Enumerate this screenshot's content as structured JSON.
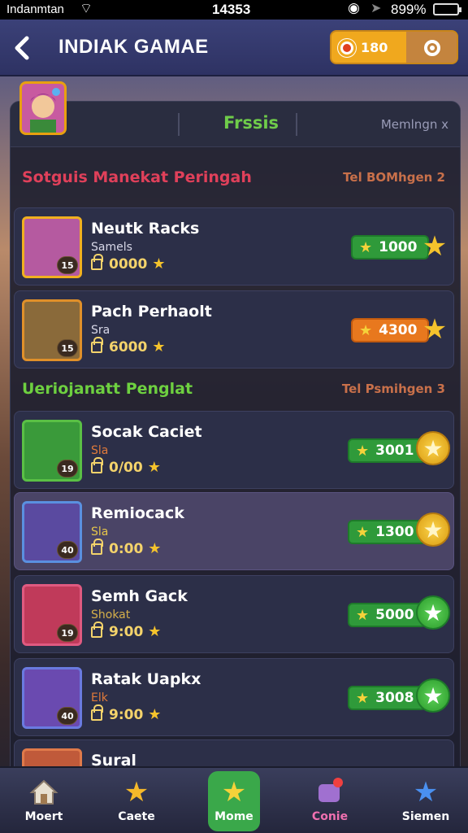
{
  "status_bar": {
    "carrier": "Indanmtan",
    "time": "14353",
    "battery": "899%"
  },
  "header": {
    "title": "INDIAK GAMAE",
    "currency_amount": "180"
  },
  "panel": {
    "active_tab": "Frssis",
    "close_text": "Memlngn x"
  },
  "sections": [
    {
      "title": "Sotguis Manekat Peringah",
      "title_color": "#e0405a",
      "note": "Tel BOMhgen 2",
      "items": [
        {
          "name": "Neutk Racks",
          "sub": "Samels",
          "time": "0000",
          "price": "1000",
          "price_color": "green",
          "level": "15",
          "portrait_bg": "#b55aa0",
          "portrait_border": "#f0b020"
        },
        {
          "name": "Pach Perhaolt",
          "sub": "Sra",
          "time": "6000",
          "price": "4300",
          "price_color": "orange",
          "level": "15",
          "portrait_bg": "#8a6a3a",
          "portrait_border": "#e0902a"
        }
      ]
    },
    {
      "title": "Ueriojanatt Penglat",
      "title_color": "#6ed040",
      "note": "Tel Psmihgen 3",
      "items": [
        {
          "name": "Socak Caciet",
          "sub": "Sla",
          "time": "0/00",
          "price": "3001",
          "price_color": "green",
          "level": "19",
          "portrait_bg": "#3a9a3a",
          "portrait_border": "#5ac045"
        },
        {
          "name": "Remiocack",
          "sub": "Sla",
          "time": "0:00",
          "price": "1300",
          "price_color": "green",
          "level": "40",
          "portrait_bg": "#5a4aa0",
          "portrait_border": "#5a90e0"
        },
        {
          "name": "Semh Gack",
          "sub": "Shokat",
          "time": "9:00",
          "price": "5000",
          "price_color": "green",
          "level": "19",
          "portrait_bg": "#c03a5a",
          "portrait_border": "#e05a80"
        },
        {
          "name": "Ratak Uapkx",
          "sub": "Elk",
          "time": "9:00",
          "price": "3008",
          "price_color": "green",
          "level": "40",
          "portrait_bg": "#6a4ab0",
          "portrait_border": "#6a7ae0"
        },
        {
          "name": "Sural",
          "sub": "",
          "time": "",
          "price": "",
          "price_color": "green",
          "level": "",
          "portrait_bg": "#c05a3a",
          "portrait_border": "#e07a4a"
        }
      ]
    }
  ],
  "bottom_nav": [
    {
      "label": "Moert",
      "icon": "home-icon",
      "color": "#fff"
    },
    {
      "label": "Caete",
      "icon": "star-icon",
      "color": "#fff"
    },
    {
      "label": "Mome",
      "icon": "star-icon",
      "color": "#fff"
    },
    {
      "label": "Conie",
      "icon": "chat-icon",
      "color": "#f070b0"
    },
    {
      "label": "Siemen",
      "icon": "star-blue-icon",
      "color": "#fff"
    }
  ]
}
